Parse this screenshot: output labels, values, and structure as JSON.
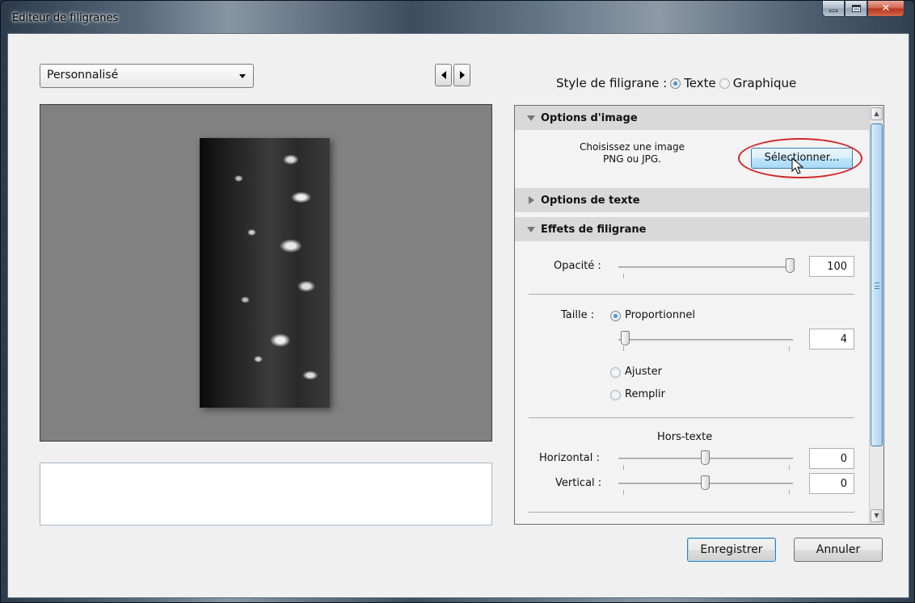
{
  "window": {
    "title": "Editeur de filigranes"
  },
  "preset": {
    "selected": "Personnalisé"
  },
  "style": {
    "label": "Style de filigrane :",
    "options": [
      {
        "label": "Texte",
        "selected": true
      },
      {
        "label": "Graphique",
        "selected": false
      }
    ]
  },
  "image_options": {
    "header": "Options d'image",
    "prompt_line1": "Choisissez une image",
    "prompt_line2": "PNG ou JPG.",
    "select_button": "Sélectionner..."
  },
  "text_options": {
    "header": "Options de texte"
  },
  "effects": {
    "header": "Effets de filigrane",
    "opacity": {
      "label": "Opacité :",
      "value": "100"
    },
    "size": {
      "label": "Taille :",
      "proportional_label": "Proportionnel",
      "value": "4",
      "fit_label": "Ajuster",
      "fill_label": "Remplir",
      "selected": "Proportionnel"
    },
    "offset": {
      "label": "Hors-texte",
      "horizontal_label": "Horizontal :",
      "horizontal_value": "0",
      "vertical_label": "Vertical :",
      "vertical_value": "0"
    }
  },
  "buttons": {
    "save": "Enregistrer",
    "cancel": "Annuler"
  },
  "icons": [
    "minimize-icon",
    "maximize-icon",
    "close-icon",
    "chevron-down-icon",
    "arrow-left-icon",
    "arrow-right-icon",
    "triangle-down-icon",
    "triangle-right-icon",
    "mouse-cursor-icon"
  ]
}
